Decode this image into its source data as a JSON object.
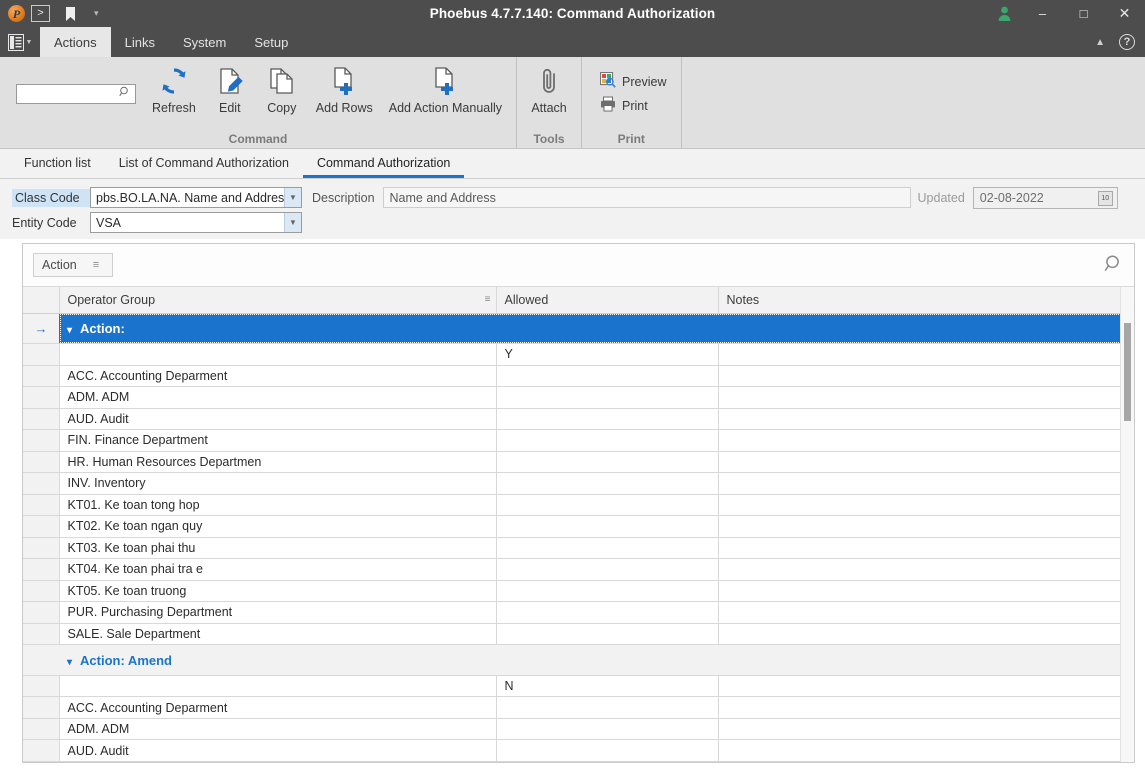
{
  "titlebar": {
    "title": "Phoebus 4.7.7.140: Command Authorization",
    "logo_icon": "phoebus-logo-icon",
    "forward_btn": ">",
    "bookmark_icon": "bookmark-icon",
    "caret_icon": "chevron-down-icon",
    "user_icon": "user-icon",
    "minimize": "–",
    "maximize": "□",
    "close": "✕"
  },
  "menubar": {
    "app_icon": "application-menu-icon",
    "items": [
      {
        "label": "Actions",
        "active": true
      },
      {
        "label": "Links",
        "active": false
      },
      {
        "label": "System",
        "active": false
      },
      {
        "label": "Setup",
        "active": false
      }
    ],
    "collapse_icon": "chevron-up-icon",
    "help_label": "?"
  },
  "ribbon": {
    "search": {
      "value": "",
      "placeholder": "",
      "icon": "search-icon"
    },
    "groups": [
      {
        "caption": "Command",
        "buttons": [
          {
            "label": "Refresh",
            "icon": "refresh-icon"
          },
          {
            "label": "Edit",
            "icon": "edit-pencil-icon"
          },
          {
            "label": "Copy",
            "icon": "copy-icon"
          },
          {
            "label": "Add Rows",
            "icon": "add-rows-icon"
          },
          {
            "label": "Add Action Manually",
            "icon": "add-action-icon"
          }
        ]
      },
      {
        "caption": "Tools",
        "buttons": [
          {
            "label": "Attach",
            "icon": "paperclip-icon"
          }
        ]
      },
      {
        "caption": "Print",
        "buttons": [
          {
            "label": "Preview",
            "icon": "preview-icon"
          },
          {
            "label": "Print",
            "icon": "printer-icon"
          }
        ]
      }
    ]
  },
  "tabs": [
    {
      "label": "Function list",
      "active": false
    },
    {
      "label": "List of Command Authorization",
      "active": false
    },
    {
      "label": "Command Authorization",
      "active": true
    }
  ],
  "form": {
    "class_code_label": "Class Code",
    "class_code_value": "pbs.BO.LA.NA. Name and Address",
    "entity_code_label": "Entity Code",
    "entity_code_value": "VSA",
    "description_label": "Description",
    "description_value": "Name and Address",
    "updated_label": "Updated",
    "updated_value": "02-08-2022",
    "calendar_icon": "calendar-icon",
    "dropdown_icon": "chevron-down-icon"
  },
  "grid_toolbar": {
    "action_chip_label": "Action",
    "sort_icon": "sort-icon",
    "search_icon": "search-icon"
  },
  "grid": {
    "columns": [
      "Operator Group",
      "Allowed",
      "Notes"
    ],
    "rows": [
      {
        "type": "group",
        "label": "Action:",
        "selected": true
      },
      {
        "type": "data",
        "group": "",
        "allowed": "Y",
        "notes": ""
      },
      {
        "type": "data",
        "group": "ACC. Accounting Deparment",
        "allowed": "",
        "notes": ""
      },
      {
        "type": "data",
        "group": "ADM. ADM",
        "allowed": "",
        "notes": ""
      },
      {
        "type": "data",
        "group": "AUD. Audit",
        "allowed": "",
        "notes": ""
      },
      {
        "type": "data",
        "group": "FIN. Finance Department",
        "allowed": "",
        "notes": ""
      },
      {
        "type": "data",
        "group": "HR. Human Resources Departmen",
        "allowed": "",
        "notes": ""
      },
      {
        "type": "data",
        "group": "INV. Inventory",
        "allowed": "",
        "notes": ""
      },
      {
        "type": "data",
        "group": "KT01. Ke toan tong hop",
        "allowed": "",
        "notes": ""
      },
      {
        "type": "data",
        "group": "KT02. Ke toan ngan quy",
        "allowed": "",
        "notes": ""
      },
      {
        "type": "data",
        "group": "KT03. Ke toan phai thu",
        "allowed": "",
        "notes": ""
      },
      {
        "type": "data",
        "group": "KT04. Ke toan phai tra e",
        "allowed": "",
        "notes": ""
      },
      {
        "type": "data",
        "group": "KT05. Ke toan truong",
        "allowed": "",
        "notes": ""
      },
      {
        "type": "data",
        "group": "PUR. Purchasing Department",
        "allowed": "",
        "notes": ""
      },
      {
        "type": "data",
        "group": "SALE. Sale Department",
        "allowed": "",
        "notes": ""
      },
      {
        "type": "group",
        "label": "Action: Amend",
        "selected": false
      },
      {
        "type": "data",
        "group": "",
        "allowed": "N",
        "notes": ""
      },
      {
        "type": "data",
        "group": "ACC. Accounting Deparment",
        "allowed": "",
        "notes": ""
      },
      {
        "type": "data",
        "group": "ADM. ADM",
        "allowed": "",
        "notes": ""
      },
      {
        "type": "data",
        "group": "AUD. Audit",
        "allowed": "",
        "notes": ""
      }
    ]
  },
  "colors": {
    "accent": "#1a75c9",
    "selection": "#1a73cc",
    "titlebar": "#4d4d4d",
    "ribbon": "#e0e0e0",
    "highlight": "#cfe3f7"
  }
}
